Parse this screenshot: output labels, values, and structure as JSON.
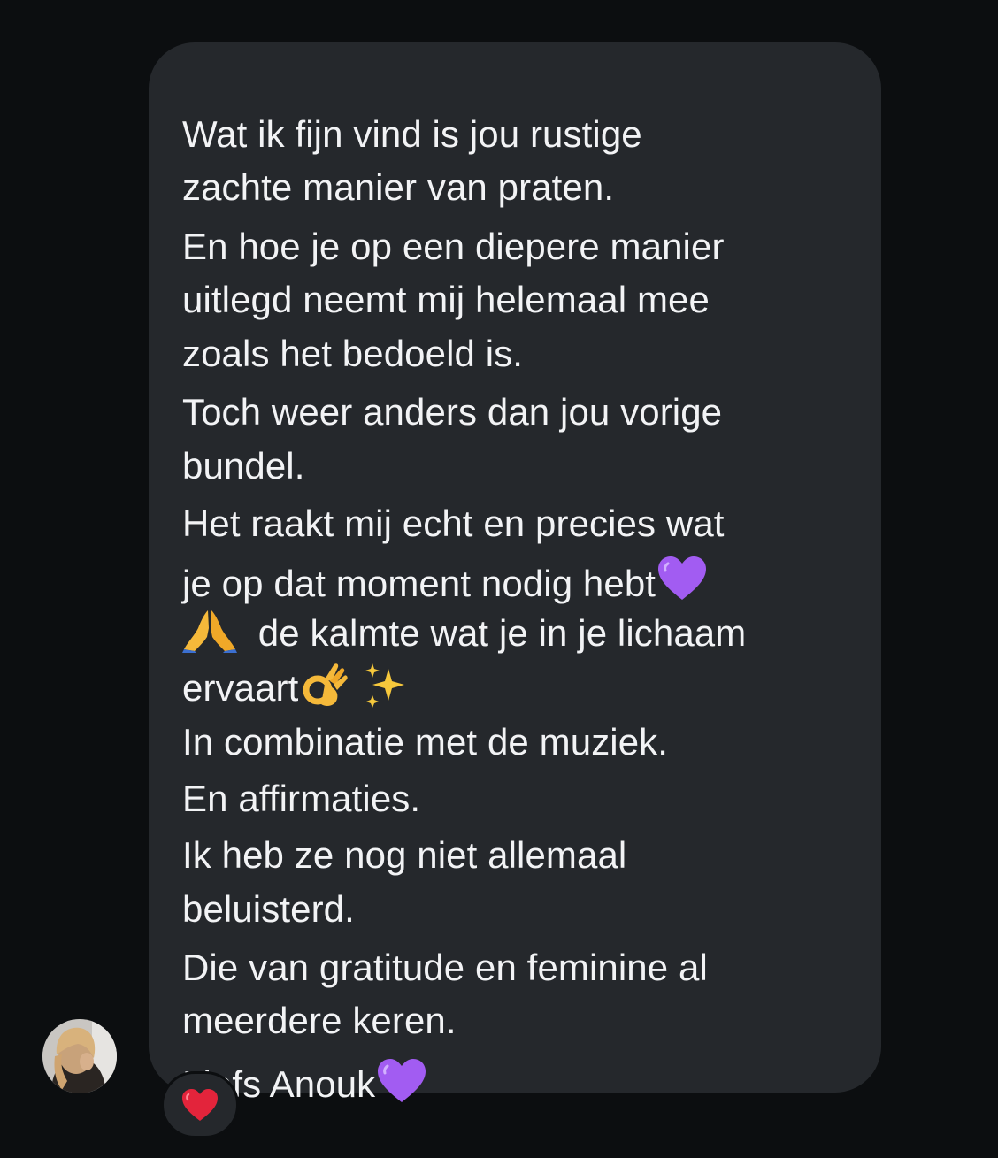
{
  "message": {
    "lines": [
      "Wat ik fijn vind is jou rustige",
      "zachte manier van praten.",
      "En hoe je op een diepere manier",
      "uitlegd neemt mij helemaal mee",
      "zoals het bedoeld is.",
      "Toch weer anders dan jou vorige",
      "bundel.",
      "Het raakt mij echt en precies wat",
      "je op dat moment nodig hebt",
      " de kalmte wat je in je lichaam",
      "ervaart",
      "In combinatie met de muziek.",
      "En affirmaties.",
      "Ik heb ze nog niet allemaal",
      "beluisterd.",
      "Die van gratitude en feminine al",
      "meerdere keren.",
      "Liefs Anouk"
    ],
    "emoji_icons": [
      "purple-heart-icon",
      "folded-hands-icon",
      "ok-hand-icon",
      "sparkles-icon"
    ]
  },
  "reaction": {
    "icon": "red-heart-icon"
  },
  "colors": {
    "background": "#0c0e10",
    "bubble": "#25282c",
    "text": "#f2f3f5",
    "purple_heart": "#a25cf2",
    "red_heart": "#e3243b",
    "ok_hand": "#f5b93a",
    "sparkles": "#f6c83c",
    "folded_hands": "#f5b93a"
  }
}
